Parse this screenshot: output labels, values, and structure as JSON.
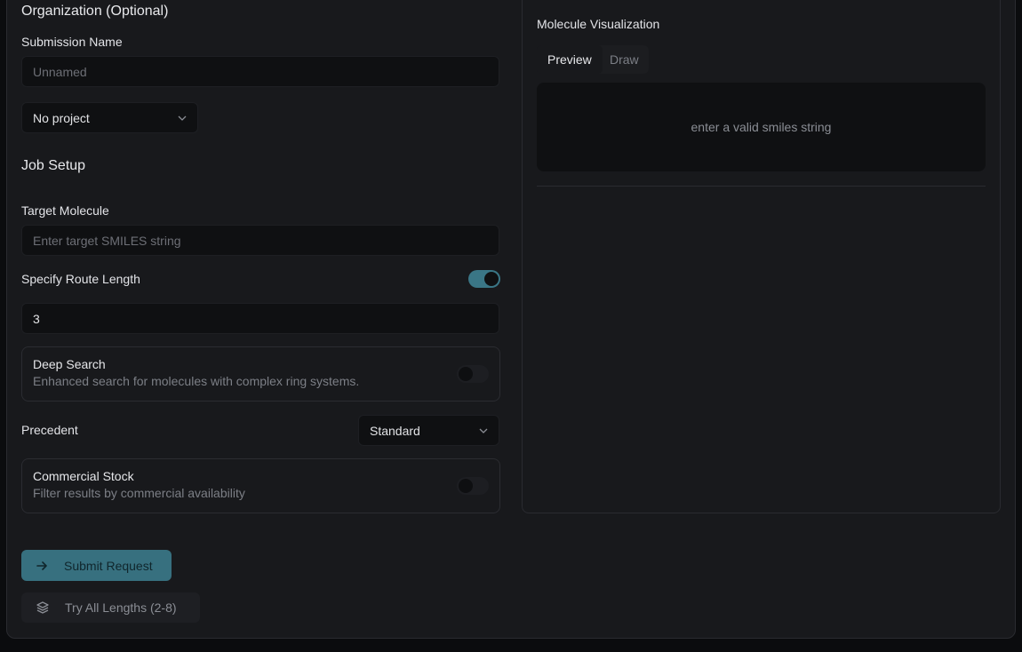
{
  "organization": {
    "title": "Organization (Optional)"
  },
  "submission": {
    "label": "Submission Name",
    "placeholder": "Unnamed",
    "project_select": "No project"
  },
  "job_setup": {
    "title": "Job Setup",
    "target_label": "Target Molecule",
    "target_placeholder": "Enter target SMILES string",
    "route_length_label": "Specify Route Length",
    "route_length_enabled": true,
    "route_length_value": "3",
    "deep_search": {
      "title": "Deep Search",
      "description": "Enhanced search for molecules with complex ring systems.",
      "enabled": false
    },
    "precedent_label": "Precedent",
    "precedent_value": "Standard",
    "commercial_stock": {
      "title": "Commercial Stock",
      "description": "Filter results by commercial availability",
      "enabled": false
    }
  },
  "visualization": {
    "title": "Molecule Visualization",
    "tabs": [
      {
        "label": "Preview",
        "active": true
      },
      {
        "label": "Draw",
        "active": false
      }
    ],
    "empty_message": "enter a valid smiles string"
  },
  "actions": {
    "submit_label": "Submit Request",
    "try_all_label": "Try All Lengths (2-8)"
  },
  "colors": {
    "accent": "#37707f",
    "background": "#18191c",
    "input_bg": "#0f1012"
  }
}
